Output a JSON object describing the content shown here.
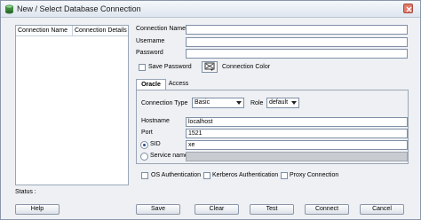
{
  "window": {
    "title": "New / Select Database Connection"
  },
  "list": {
    "columns": [
      "Connection Name",
      "Connection Details"
    ]
  },
  "form": {
    "connection_name_label": "Connection Name",
    "connection_name_value": "",
    "username_label": "Username",
    "username_value": "",
    "password_label": "Password",
    "password_value": "",
    "save_password_label": "Save Password",
    "connection_color_label": "Connection Color"
  },
  "tabs": [
    "Oracle",
    "Access"
  ],
  "oracle": {
    "connection_type_label": "Connection Type",
    "connection_type_value": "Basic",
    "role_label": "Role",
    "role_value": "default",
    "hostname_label": "Hostname",
    "hostname_value": "localhost",
    "port_label": "Port",
    "port_value": "1521",
    "sid_label": "SID",
    "sid_value": "xe",
    "service_name_label": "Service name",
    "service_name_value": ""
  },
  "options": {
    "os_auth": "OS Authentication",
    "kerberos_auth": "Kerberos Authentication",
    "proxy": "Proxy Connection"
  },
  "status": {
    "label": "Status :"
  },
  "buttons": {
    "help": "Help",
    "save": "Save",
    "clear": "Clear",
    "test": "Test",
    "connect": "Connect",
    "cancel": "Cancel"
  }
}
